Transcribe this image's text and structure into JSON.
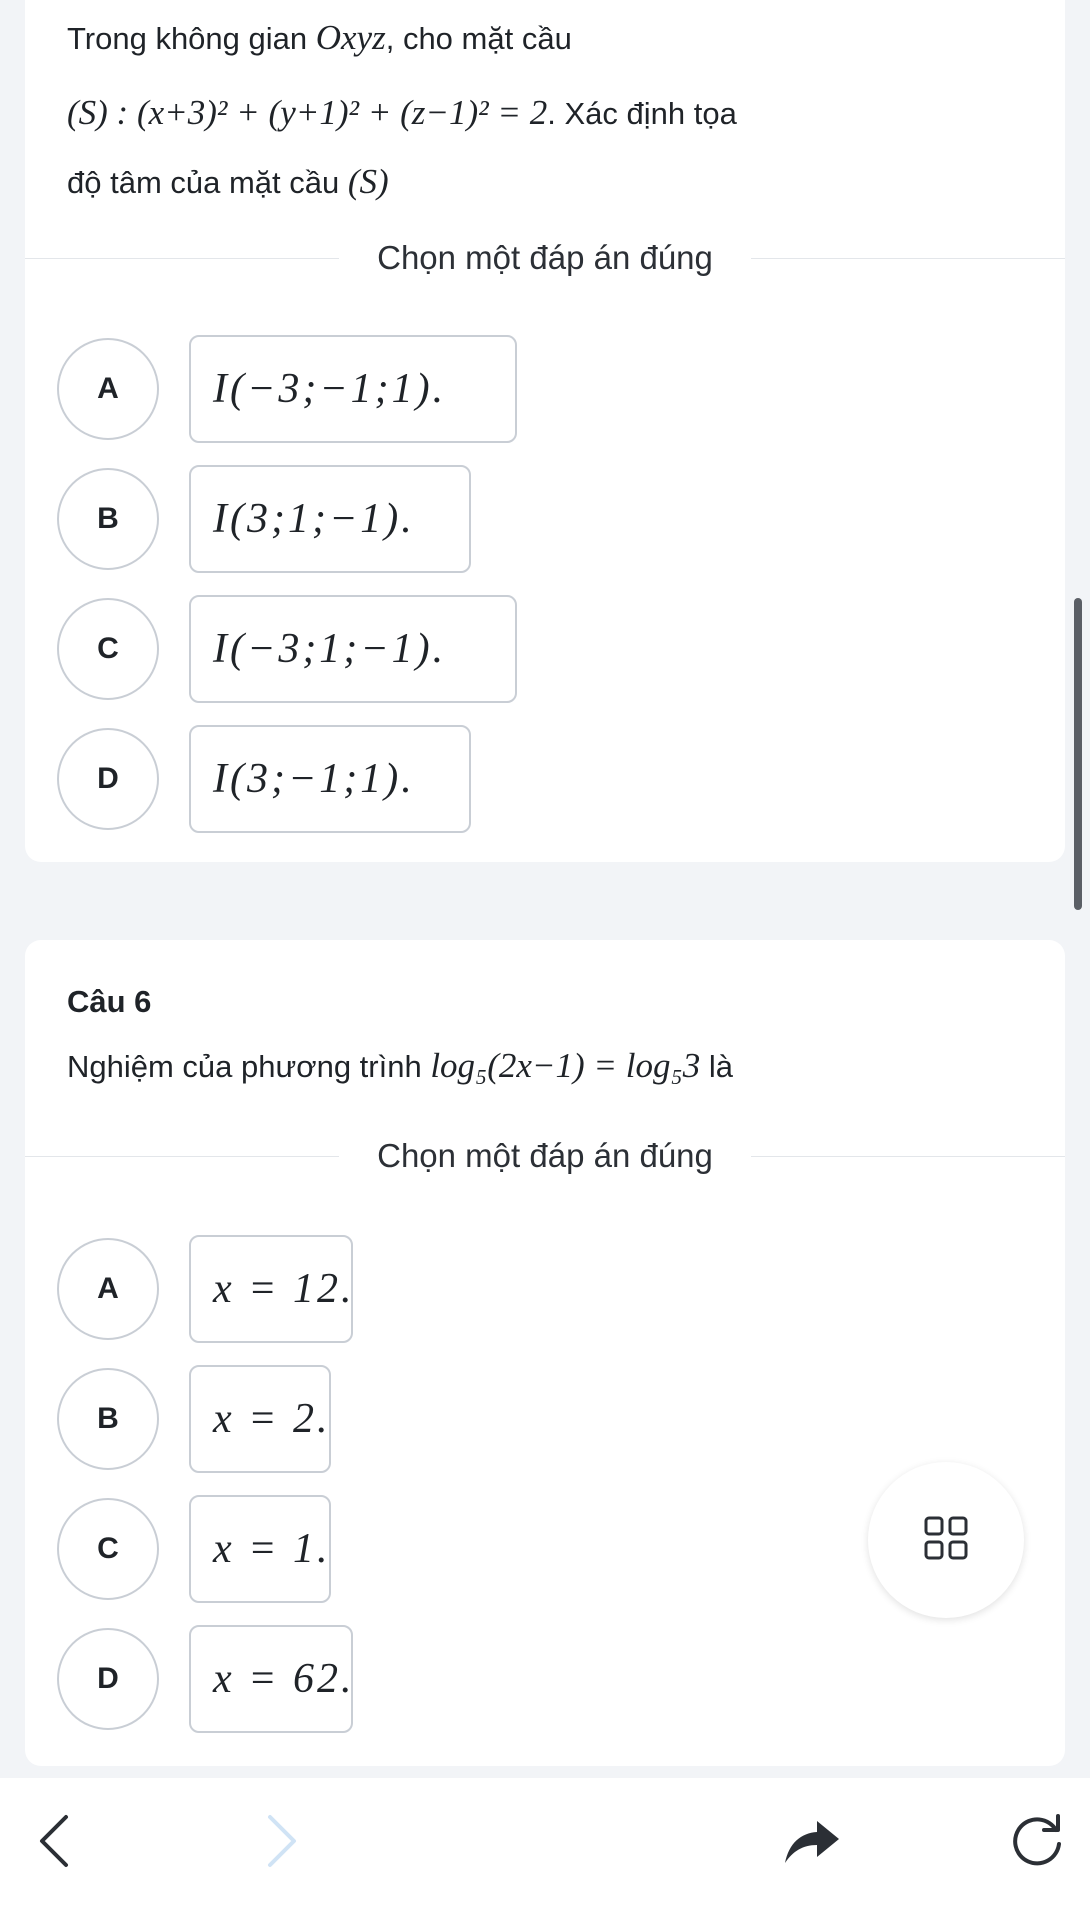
{
  "question5": {
    "line1_text": "Trong không gian ",
    "line1_math": "Oxyz",
    "line1_after": ", cho mặt cầu",
    "line2_math": "(S) : (x+3)² + (y+1)² + (z−1)² = 2",
    "line2_after": ". Xác định tọa",
    "line3_text": "độ tâm của mặt cầu ",
    "line3_math": "(S)",
    "choose_label": "Chọn một đáp án đúng",
    "options": [
      {
        "letter": "A",
        "answer": "I(−3;−1;1)."
      },
      {
        "letter": "B",
        "answer": "I(3;1;−1)."
      },
      {
        "letter": "C",
        "answer": "I(−3;1;−1)."
      },
      {
        "letter": "D",
        "answer": "I(3;−1;1)."
      }
    ]
  },
  "question6": {
    "title": "Câu 6",
    "text_before": "Nghiệm của phương trình ",
    "math": "log₅(2x−1) = log₅3",
    "text_after": " là",
    "choose_label": "Chọn một đáp án đúng",
    "options": [
      {
        "letter": "A",
        "answer": "x = 12."
      },
      {
        "letter": "B",
        "answer": "x = 2."
      },
      {
        "letter": "C",
        "answer": "x = 1."
      },
      {
        "letter": "D",
        "answer": "x = 62."
      }
    ]
  },
  "icons": {
    "fab": "grid-icon",
    "back": "chevron-left-icon",
    "forward": "chevron-right-icon",
    "share": "forward-arrow-icon",
    "reload": "reload-icon"
  },
  "colors": {
    "background": "#f2f4f7",
    "card": "#ffffff",
    "border": "#c9ced5",
    "text": "#1f2328",
    "disabled": "#d0e3f5"
  }
}
